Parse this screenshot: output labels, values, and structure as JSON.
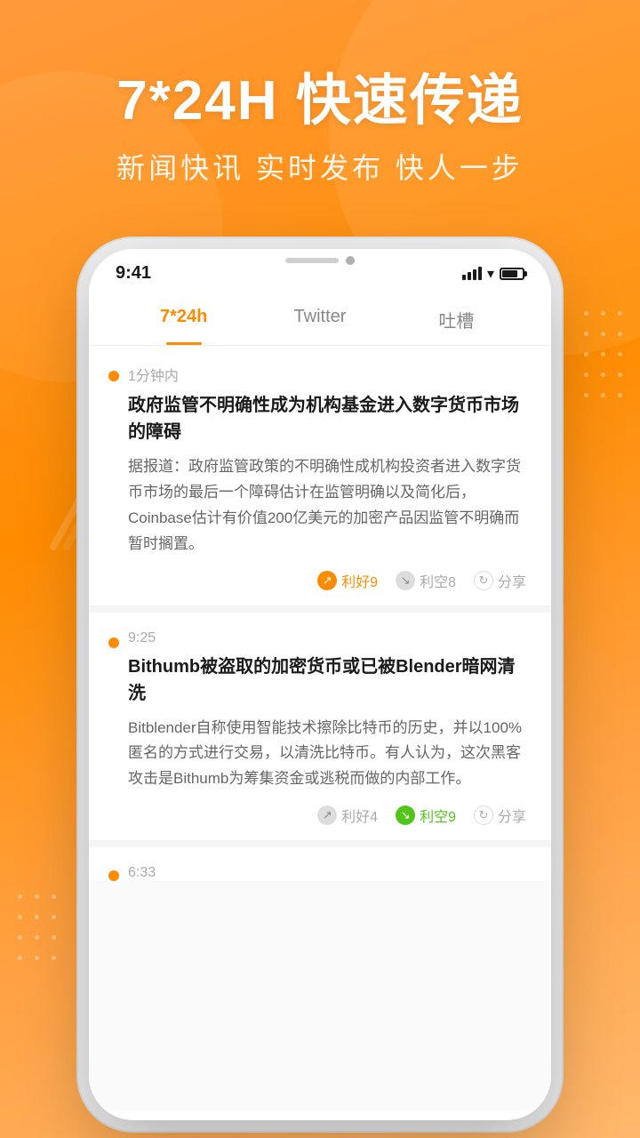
{
  "header": {
    "title": "7*24H 快速传递",
    "subtitle": "新闻快讯 实时发布 快人一步"
  },
  "phone": {
    "status": {
      "time": "9:41"
    },
    "tabs": [
      {
        "id": "tab-7x24",
        "label": "7*24h",
        "active": true
      },
      {
        "id": "tab-twitter",
        "label": "Twitter",
        "active": false
      },
      {
        "id": "tab-tuhao",
        "label": "吐槽",
        "active": false
      }
    ],
    "news": [
      {
        "id": "news-1",
        "time": "1分钟内",
        "title": "政府监管不明确性成为机构基金进入数字货币市场的障碍",
        "body": "据报道：政府监管政策的不明确性成机构投资者进入数字货币市场的最后一个障碍估计在监管明确以及简化后，Coinbase估计有价值200亿美元的加密产品因监管不明确而暂时搁置。",
        "actions": {
          "bullish": {
            "label": "利好9",
            "type": "bullish"
          },
          "bearish": {
            "label": "利空8",
            "type": "bearish-gray"
          },
          "share": {
            "label": "分享",
            "type": "share"
          }
        }
      },
      {
        "id": "news-2",
        "time": "9:25",
        "title": "Bithumb被盗取的加密货币或已被Blender暗网清洗",
        "body": "Bitblender自称使用智能技术擦除比特币的历史，并以100%匿名的方式进行交易，以清洗比特币。有人认为，这次黑客攻击是Bithumb为筹集资金或逃税而做的内部工作。",
        "actions": {
          "bullish": {
            "label": "利好4",
            "type": "bullish-gray"
          },
          "bearish": {
            "label": "利空9",
            "type": "bearish-green"
          },
          "share": {
            "label": "分享",
            "type": "share"
          }
        }
      },
      {
        "id": "news-3",
        "time": "6:33",
        "title": "",
        "body": ""
      }
    ]
  }
}
